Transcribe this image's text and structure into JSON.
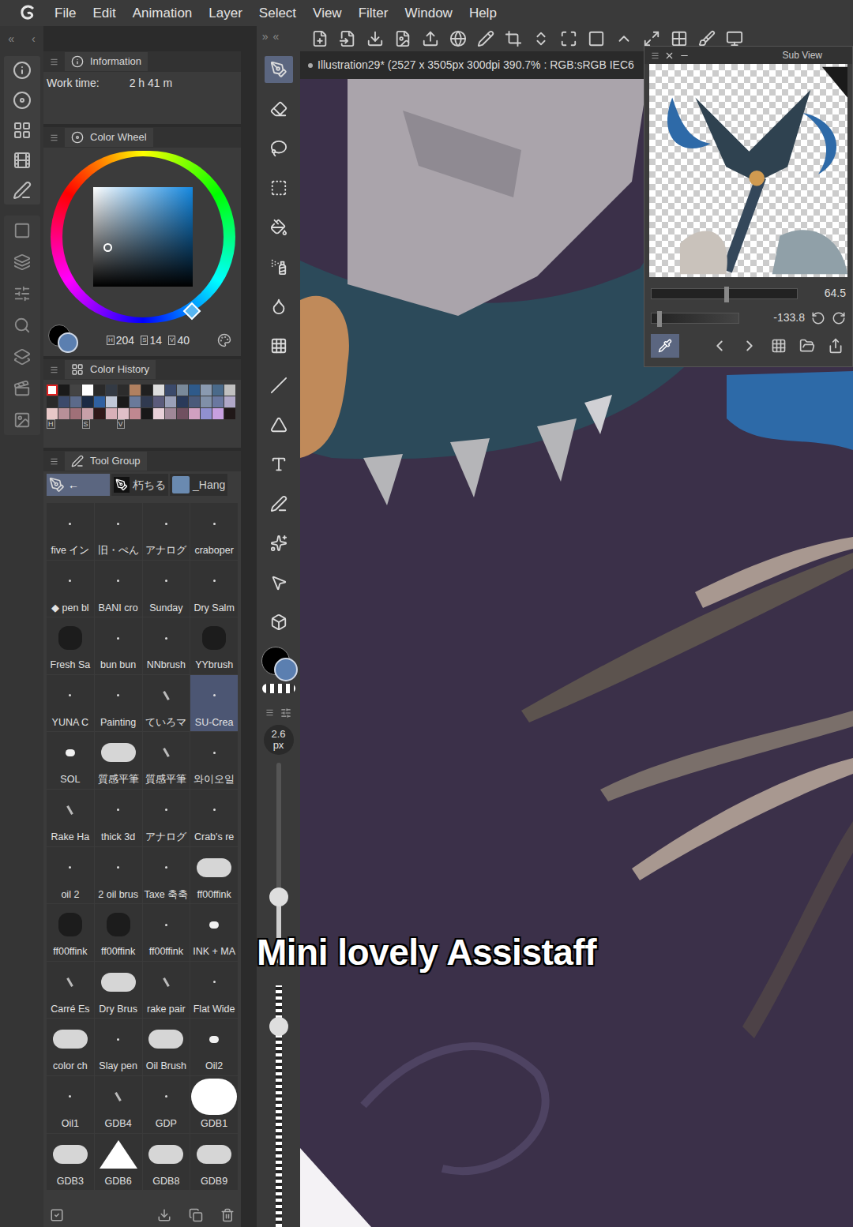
{
  "menu": {
    "items": [
      "File",
      "Edit",
      "Animation",
      "Layer",
      "Select",
      "View",
      "Filter",
      "Window",
      "Help"
    ]
  },
  "collapse_left": [
    "«",
    "‹"
  ],
  "collapse_right": [
    "»",
    "«"
  ],
  "information": {
    "title": "Information",
    "label": "Work time:",
    "value": "2 h 41 m"
  },
  "color_wheel": {
    "title": "Color Wheel",
    "channels": [
      {
        "label": "H",
        "value": "204"
      },
      {
        "label": "S",
        "value": "14"
      },
      {
        "label": "V",
        "value": "40"
      }
    ],
    "hue": 204,
    "saturation": 0.14,
    "brightness": 0.4
  },
  "color_history": {
    "title": "Color History",
    "mode_labels": [
      "H",
      "S",
      "V"
    ],
    "swatches": [
      {
        "color": "#ffffff",
        "selected": true
      },
      {
        "color": "#1a1a1a",
        "selected": false
      },
      {
        "color": "#444444",
        "selected": false
      },
      {
        "color": "#ffffff",
        "selected": false
      },
      {
        "color": "#2a2a2a",
        "selected": false
      },
      {
        "color": "#333a44",
        "selected": false
      },
      {
        "color": "#2c2c2c",
        "selected": false
      },
      {
        "color": "#b08060",
        "selected": false
      },
      {
        "color": "#202020",
        "selected": false
      },
      {
        "color": "#dddddd",
        "selected": false
      },
      {
        "color": "#3b4a6b",
        "selected": false
      },
      {
        "color": "#7a8a9a",
        "selected": false
      },
      {
        "color": "#2e5a8a",
        "selected": false
      },
      {
        "color": "#8a9ab0",
        "selected": false
      },
      {
        "color": "#4a6a8a",
        "selected": false
      },
      {
        "color": "#c0c0c0",
        "selected": false
      },
      {
        "color": "#2a2a2a",
        "selected": false
      },
      {
        "color": "#3b4a6b",
        "selected": false
      },
      {
        "color": "#5b6a8a",
        "selected": false
      },
      {
        "color": "#1a2a44",
        "selected": false
      },
      {
        "color": "#3060a0",
        "selected": false
      },
      {
        "color": "#c0c8d8",
        "selected": false
      },
      {
        "color": "#1a1a1a",
        "selected": false
      },
      {
        "color": "#6a7a9a",
        "selected": false
      },
      {
        "color": "#303a50",
        "selected": false
      },
      {
        "color": "#5b5b7b",
        "selected": false
      },
      {
        "color": "#9aa0b8",
        "selected": false
      },
      {
        "color": "#2a3a5a",
        "selected": false
      },
      {
        "color": "#4a5a7a",
        "selected": false
      },
      {
        "color": "#8090a8",
        "selected": false
      },
      {
        "color": "#6a78a0",
        "selected": false
      },
      {
        "color": "#b0a8c8",
        "selected": false
      },
      {
        "color": "#e8c8c8",
        "selected": false
      },
      {
        "color": "#b89098",
        "selected": false
      },
      {
        "color": "#a07078",
        "selected": false
      },
      {
        "color": "#c8a0a8",
        "selected": false
      },
      {
        "color": "#301818",
        "selected": false
      },
      {
        "color": "#d8b0b8",
        "selected": false
      },
      {
        "color": "#e0c0c8",
        "selected": false
      },
      {
        "color": "#c08890",
        "selected": false
      },
      {
        "color": "#181818",
        "selected": false
      },
      {
        "color": "#e8d0d8",
        "selected": false
      },
      {
        "color": "#a08898",
        "selected": false
      },
      {
        "color": "#705060",
        "selected": false
      },
      {
        "color": "#d0a0c0",
        "selected": false
      },
      {
        "color": "#9090d0",
        "selected": false
      },
      {
        "color": "#c8a0e0",
        "selected": false
      },
      {
        "color": "#201818",
        "selected": false
      }
    ]
  },
  "tool_group": {
    "title": "Tool Group",
    "tabs": [
      {
        "label": "←",
        "selected": true
      },
      {
        "label": "朽ちる",
        "selected": false
      },
      {
        "label": "_Hang",
        "selected": false
      }
    ],
    "brushes": [
      {
        "name": "five イン",
        "kind": "dot",
        "selected": false
      },
      {
        "name": "旧・ぺん",
        "kind": "dot",
        "selected": false
      },
      {
        "name": "アナログ",
        "kind": "dot",
        "selected": false
      },
      {
        "name": "craboper",
        "kind": "dot",
        "selected": false
      },
      {
        "name": "◆ pen bl",
        "kind": "dot",
        "selected": false
      },
      {
        "name": "BANI cro",
        "kind": "dot",
        "selected": false
      },
      {
        "name": "Sunday",
        "kind": "dot",
        "selected": false
      },
      {
        "name": "Dry Salm",
        "kind": "dot",
        "selected": false
      },
      {
        "name": "Fresh Sa",
        "kind": "blob",
        "selected": false
      },
      {
        "name": "bun bun",
        "kind": "dot",
        "selected": false
      },
      {
        "name": "NNbrush",
        "kind": "dot",
        "selected": false
      },
      {
        "name": "YYbrush",
        "kind": "blob",
        "selected": false
      },
      {
        "name": "YUNA C",
        "kind": "dot",
        "selected": false
      },
      {
        "name": "Painting",
        "kind": "dot",
        "selected": false
      },
      {
        "name": "ていろマ",
        "kind": "stroke",
        "selected": false
      },
      {
        "name": "SU-Crea",
        "kind": "dot",
        "selected": true
      },
      {
        "name": "SOL",
        "kind": "circle",
        "selected": false
      },
      {
        "name": "質感平筆",
        "kind": "cloud",
        "selected": false
      },
      {
        "name": "質感平筆",
        "kind": "stroke",
        "selected": false
      },
      {
        "name": "와이오일",
        "kind": "dot",
        "selected": false
      },
      {
        "name": "Rake Ha",
        "kind": "stroke",
        "selected": false
      },
      {
        "name": "thick 3d",
        "kind": "dot",
        "selected": false
      },
      {
        "name": "アナログ",
        "kind": "dot",
        "selected": false
      },
      {
        "name": "Crab's re",
        "kind": "dot",
        "selected": false
      },
      {
        "name": "oil 2",
        "kind": "dot",
        "selected": false
      },
      {
        "name": "2 oil brus",
        "kind": "dot",
        "selected": false
      },
      {
        "name": "Taxe 축축",
        "kind": "dot",
        "selected": false
      },
      {
        "name": "ff00ffink",
        "kind": "cloud",
        "selected": false
      },
      {
        "name": "ff00ffink",
        "kind": "blob",
        "selected": false
      },
      {
        "name": "ff00ffink",
        "kind": "blob",
        "selected": false
      },
      {
        "name": "ff00ffink",
        "kind": "dot",
        "selected": false
      },
      {
        "name": "INK + MA",
        "kind": "circle",
        "selected": false
      },
      {
        "name": "Carré Es",
        "kind": "stroke",
        "selected": false
      },
      {
        "name": "Dry Brus",
        "kind": "cloud",
        "selected": false
      },
      {
        "name": "rake pair",
        "kind": "stroke",
        "selected": false
      },
      {
        "name": "Flat Wide",
        "kind": "dot",
        "selected": false
      },
      {
        "name": "color ch",
        "kind": "cloud",
        "selected": false
      },
      {
        "name": "Slay pen",
        "kind": "dot",
        "selected": false
      },
      {
        "name": "Oil Brush",
        "kind": "cloud",
        "selected": false
      },
      {
        "name": "Oil2",
        "kind": "circle",
        "selected": false
      },
      {
        "name": "Oil1",
        "kind": "dot",
        "selected": false
      },
      {
        "name": "GDB4",
        "kind": "stroke",
        "selected": false
      },
      {
        "name": "GDP",
        "kind": "dot",
        "selected": false
      },
      {
        "name": "GDB1",
        "kind": "bigcircle",
        "selected": false
      },
      {
        "name": "GDB3",
        "kind": "cloud",
        "selected": false
      },
      {
        "name": "GDB6",
        "kind": "triangle",
        "selected": false
      },
      {
        "name": "GDB8",
        "kind": "cloud",
        "selected": false
      },
      {
        "name": "GDB9",
        "kind": "cloud",
        "selected": false
      }
    ]
  },
  "brush_size": {
    "value": "2.6",
    "unit": "px",
    "level": 0.33
  },
  "opacity": {
    "level": 0.83
  },
  "canvas": {
    "title": "Illustration29* (2527 x 3505px 300dpi 390.7% : RGB:sRGB IEC6"
  },
  "sub_view": {
    "title": "Sub View",
    "zoom": {
      "reading": "64.5",
      "level": 0.5
    },
    "rotate": {
      "reading": "-133.8",
      "level": 0.06
    }
  },
  "caption": "Mini lovely Assistaff"
}
